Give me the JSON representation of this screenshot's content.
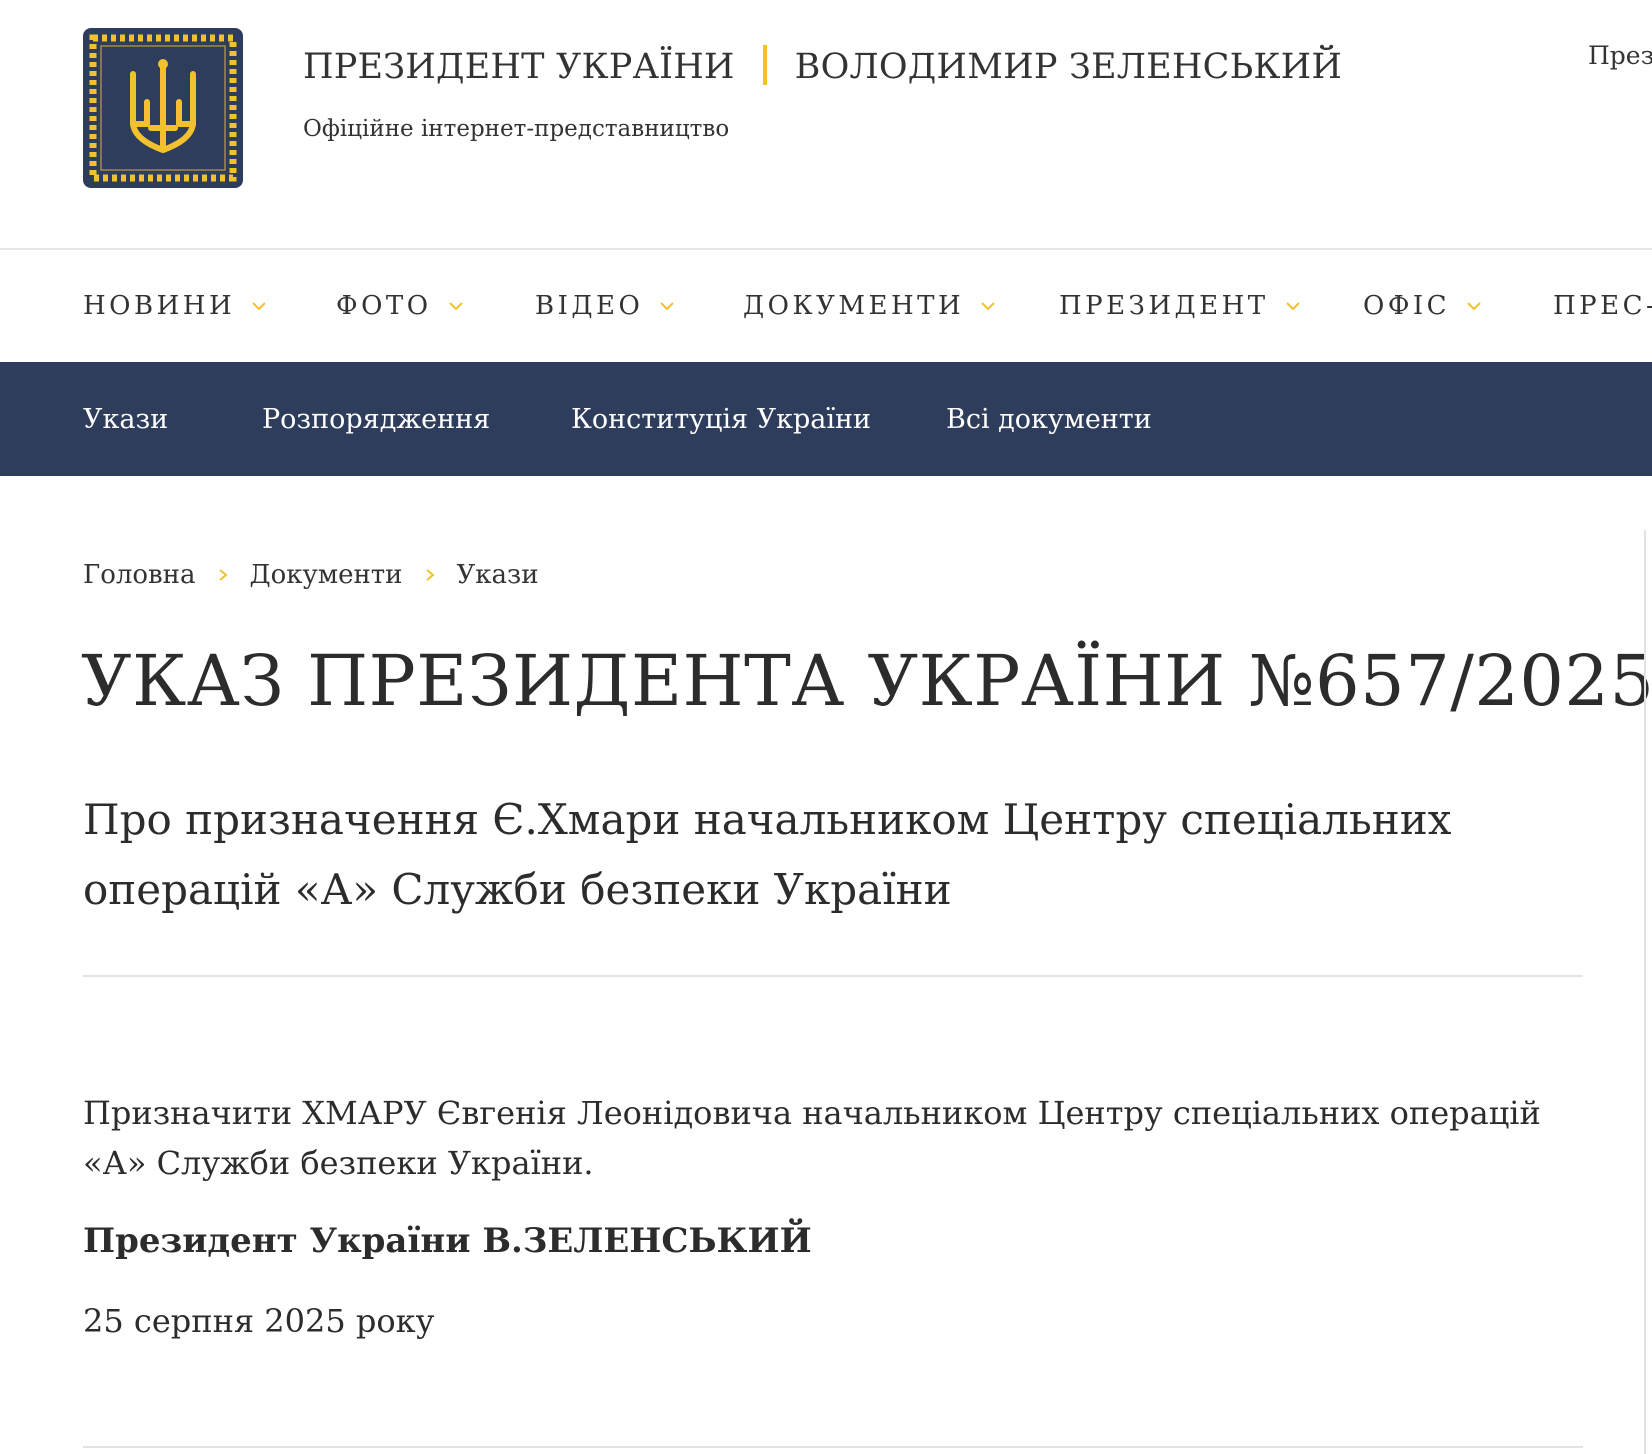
{
  "header": {
    "title_left": "ПРЕЗИДЕНТ УКРАЇНИ",
    "title_right": "ВОЛОДИМИР ЗЕЛЕНСЬКИЙ",
    "subtitle": "Офіційне інтернет-представництво",
    "top_right_link": "През",
    "logo_icon": "trident-emblem-icon"
  },
  "main_nav": {
    "items": [
      {
        "label": "НОВИНИ"
      },
      {
        "label": "ФОТО"
      },
      {
        "label": "ВІДЕО"
      },
      {
        "label": "ДОКУМЕНТИ"
      },
      {
        "label": "ПРЕЗИДЕНТ"
      },
      {
        "label": "ОФІС"
      },
      {
        "label": "ПРЕС-"
      }
    ]
  },
  "sub_nav": {
    "items": [
      {
        "label": "Укази"
      },
      {
        "label": "Розпорядження"
      },
      {
        "label": "Конституція України"
      },
      {
        "label": "Всі документи"
      }
    ]
  },
  "breadcrumb": {
    "items": [
      {
        "label": "Головна"
      },
      {
        "label": "Документи"
      },
      {
        "label": "Укази"
      }
    ]
  },
  "document": {
    "title": "УКАЗ ПРЕЗИДЕНТА УКРАЇНИ №657/2025",
    "subtitle": "Про призначення Є.Хмари начальником Центру спеціальних операцій «А» Служби безпеки України",
    "body": "Призначити ХМАРУ Євгенія Леонідовича начальником Центру спеціальних операцій «А» Служби безпеки України.",
    "signature": "Президент України В.ЗЕЛЕНСЬКИЙ",
    "date": "25 серпня 2025 року"
  },
  "colors": {
    "navy": "#2f3d5c",
    "accent_gold": "#f2c12e",
    "text": "#2c2c2c",
    "divider": "#e3e3e3"
  }
}
